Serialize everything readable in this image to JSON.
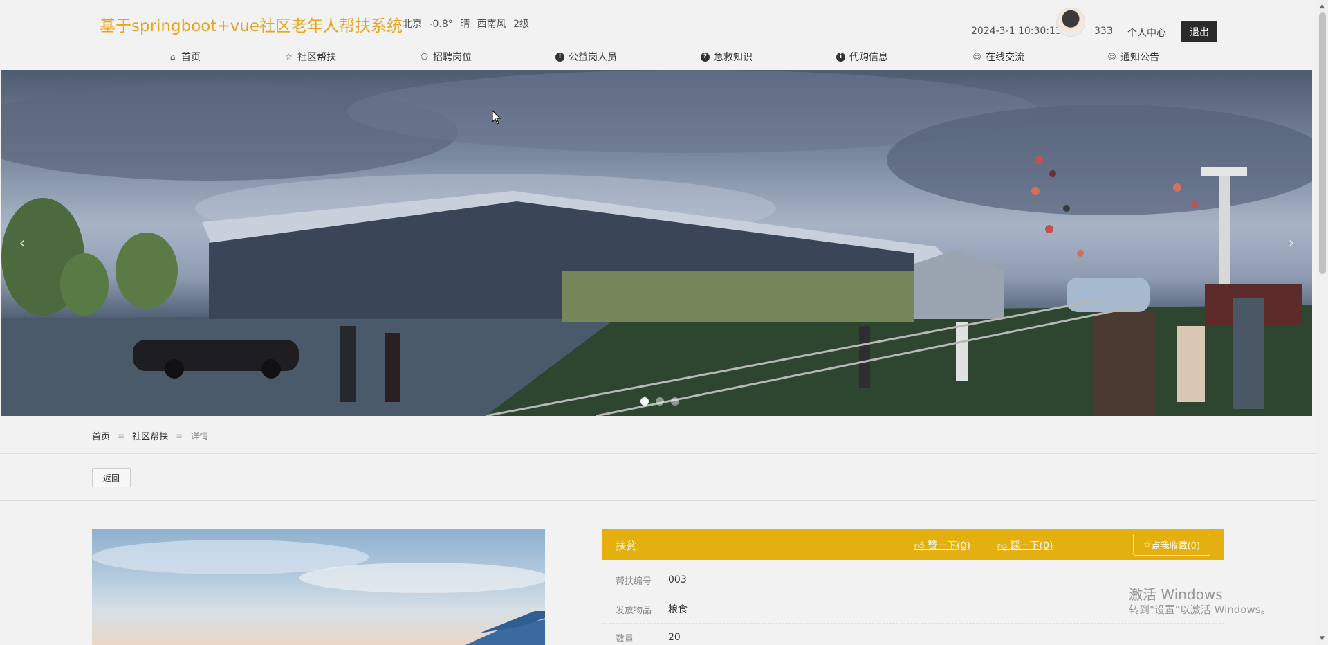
{
  "header": {
    "site_title": "基于springboot+vue社区老年人帮扶系统",
    "weather": "北京 -0.8° 晴 西南风 2级",
    "datetime": "2024-3-1 10:30:13",
    "username": "333",
    "user_center": "个人中心",
    "logout": "退出"
  },
  "nav": {
    "items": [
      {
        "label": "首页",
        "icon": "home-icon"
      },
      {
        "label": "社区帮扶",
        "icon": "star-icon"
      },
      {
        "label": "招聘岗位",
        "icon": "bag-icon"
      },
      {
        "label": "公益岗人员",
        "icon": "info-icon"
      },
      {
        "label": "急救知识",
        "icon": "question-icon"
      },
      {
        "label": "代购信息",
        "icon": "info-icon"
      },
      {
        "label": "在线交流",
        "icon": "smile-icon"
      },
      {
        "label": "通知公告",
        "icon": "smile-icon"
      }
    ]
  },
  "banner": {
    "slide_count": 3,
    "active_slide": 1,
    "prev_icon": "chevron-left-icon",
    "next_icon": "chevron-right-icon"
  },
  "breadcrumb": {
    "items": [
      "首页",
      "社区帮扶",
      "详情"
    ],
    "separator": "≡"
  },
  "detail": {
    "back": "返回",
    "title": "扶贫",
    "like": "赞一下(0)",
    "dislike": "踩一下(0)",
    "collect": "点我收藏(0)",
    "fields": [
      {
        "label": "帮扶编号",
        "value": "003"
      },
      {
        "label": "发放物品",
        "value": "粮食"
      },
      {
        "label": "数量",
        "value": "20"
      }
    ],
    "accent_color": "#e4b00f"
  },
  "watermark": {
    "line1": "激活 Windows",
    "line2": "转到\"设置\"以激活 Windows。"
  },
  "colors": {
    "title": "#e8a31c",
    "accent": "#e4b00f",
    "logout_bg": "#2b2b2b"
  }
}
